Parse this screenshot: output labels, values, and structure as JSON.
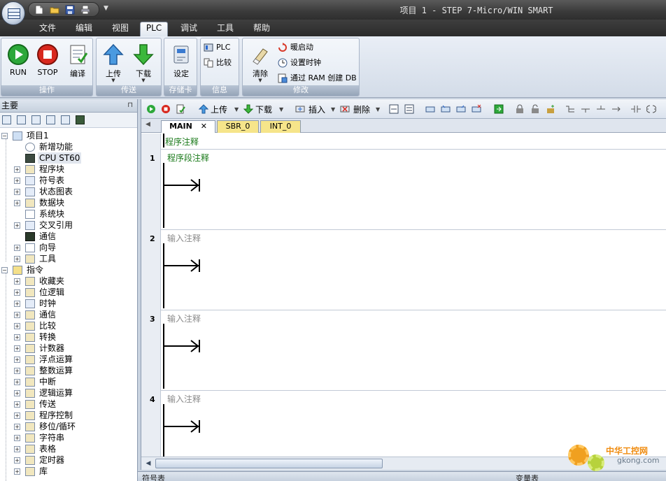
{
  "window": {
    "title": "项目 1 - STEP 7-Micro/WIN SMART"
  },
  "menu": {
    "tabs": [
      {
        "label": "文件"
      },
      {
        "label": "编辑"
      },
      {
        "label": "视图"
      },
      {
        "label": "PLC"
      },
      {
        "label": "调试"
      },
      {
        "label": "工具"
      },
      {
        "label": "帮助"
      }
    ],
    "active": "PLC"
  },
  "ribbon": {
    "groups": {
      "operate": {
        "label": "操作",
        "run": "RUN",
        "stop": "STOP",
        "compile": "编译"
      },
      "transfer": {
        "label": "传送",
        "upload": "上传",
        "download": "下载"
      },
      "memcard": {
        "label": "存储卡",
        "setup": "设定"
      },
      "info": {
        "label": "信息",
        "plc": "PLC",
        "compare": "比较"
      },
      "modify": {
        "label": "修改",
        "clear": "清除",
        "warm_start": "暖启动",
        "set_clock": "设置时钟",
        "create_db": "通过 RAM 创建 DB"
      }
    }
  },
  "left_panel": {
    "title": "主要",
    "tree": [
      {
        "label": "项目1"
      },
      {
        "label": "新增功能"
      },
      {
        "label": "CPU ST60"
      },
      {
        "label": "程序块"
      },
      {
        "label": "符号表"
      },
      {
        "label": "状态图表"
      },
      {
        "label": "数据块"
      },
      {
        "label": "系统块"
      },
      {
        "label": "交叉引用"
      },
      {
        "label": "通信"
      },
      {
        "label": "向导"
      },
      {
        "label": "工具"
      },
      {
        "label": "指令"
      },
      {
        "label": "收藏夹"
      },
      {
        "label": "位逻辑"
      },
      {
        "label": "时钟"
      },
      {
        "label": "通信"
      },
      {
        "label": "比较"
      },
      {
        "label": "转换"
      },
      {
        "label": "计数器"
      },
      {
        "label": "浮点运算"
      },
      {
        "label": "整数运算"
      },
      {
        "label": "中断"
      },
      {
        "label": "逻辑运算"
      },
      {
        "label": "传送"
      },
      {
        "label": "程序控制"
      },
      {
        "label": "移位/循环"
      },
      {
        "label": "字符串"
      },
      {
        "label": "表格"
      },
      {
        "label": "定时器"
      },
      {
        "label": "库"
      }
    ]
  },
  "editor": {
    "toolbar": {
      "upload": "上传",
      "download": "下载",
      "insert": "插入",
      "delete": "删除"
    },
    "tabs": [
      {
        "label": "MAIN"
      },
      {
        "label": "SBR_0"
      },
      {
        "label": "INT_0"
      }
    ],
    "program_comment": "程序注释",
    "networks": [
      {
        "number": "1",
        "comment": "程序段注释"
      },
      {
        "number": "2",
        "comment": "输入注释"
      },
      {
        "number": "3",
        "comment": "输入注释"
      },
      {
        "number": "4",
        "comment": "输入注释"
      }
    ]
  },
  "bottom_dock": {
    "symbol_table": "符号表",
    "variable_table": "变量表"
  },
  "watermark": {
    "brand": "中华工控网",
    "site": "gkong.com"
  }
}
